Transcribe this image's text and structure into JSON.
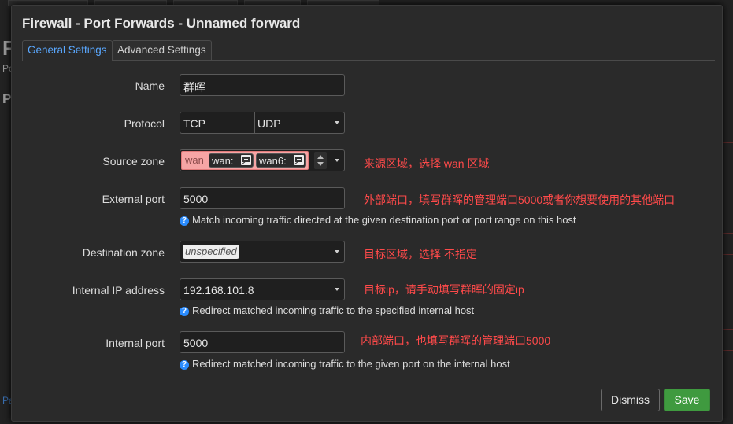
{
  "modal": {
    "title": "Firewall - Port Forwards - Unnamed forward",
    "tabs": [
      {
        "label": "General Settings",
        "active": true
      },
      {
        "label": "Advanced Settings",
        "active": false
      }
    ]
  },
  "background": {
    "letter_f": "F",
    "letter_p": "P",
    "letter_po": "Po",
    "letter_pa": "Pa"
  },
  "form": {
    "name": {
      "label": "Name",
      "value": "群晖"
    },
    "protocol": {
      "label": "Protocol",
      "values": [
        "TCP",
        "UDP"
      ]
    },
    "source_zone": {
      "label": "Source zone",
      "chips": [
        {
          "text": "wan",
          "style": "zone"
        },
        {
          "text": "wan:",
          "style": "iface",
          "icon": "network-port-icon"
        },
        {
          "text": "wan6:",
          "style": "iface",
          "icon": "network-port-icon"
        }
      ]
    },
    "external_port": {
      "label": "External port",
      "value": "5000",
      "help": "Match incoming traffic directed at the given destination port or port range on this host"
    },
    "destination_zone": {
      "label": "Destination zone",
      "value": "unspecified"
    },
    "internal_ip": {
      "label": "Internal IP address",
      "value": "192.168.101.8",
      "help": "Redirect matched incoming traffic to the specified internal host"
    },
    "internal_port": {
      "label": "Internal port",
      "value": "5000",
      "help": "Redirect matched incoming traffic to the given port on the internal host"
    }
  },
  "annotations": {
    "source_zone": "来源区域，选择 wan 区域",
    "external_port": "外部端口，填写群晖的管理端口5000或者你想要使用的其他端口",
    "destination_zone": "目标区域，选择 不指定",
    "internal_ip": "目标ip，请手动填写群晖的固定ip",
    "internal_port": "内部端口，也填写群晖的管理端口5000"
  },
  "buttons": {
    "dismiss": "Dismiss",
    "save": "Save"
  },
  "colors": {
    "accent": "#5aa8ff",
    "save": "#3f9a3f",
    "annotation": "#ff4a4a",
    "zone_chip": "#f6a5a5"
  }
}
